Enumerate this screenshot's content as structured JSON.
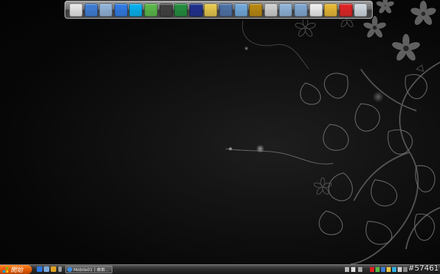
{
  "desktop": {
    "wallpaper": "dark-floral-vines",
    "background_color": "#050505"
  },
  "dock": {
    "icons": [
      {
        "name": "notepad-icon",
        "color": "#e8e8e8"
      },
      {
        "name": "network-globe-icon",
        "color": "#3a7bd5"
      },
      {
        "name": "folder-icon",
        "color": "#8fb3d9"
      },
      {
        "name": "internet-explorer-icon",
        "color": "#2b78e4"
      },
      {
        "name": "skype-icon",
        "color": "#00aff0"
      },
      {
        "name": "msn-messenger-icon",
        "color": "#57b846"
      },
      {
        "name": "qq-penguin-icon",
        "color": "#3c3c3c"
      },
      {
        "name": "tree-app-icon",
        "color": "#1e8c3a"
      },
      {
        "name": "diamond-app-icon",
        "color": "#1a2c8c"
      },
      {
        "name": "folder-search-icon",
        "color": "#e8c84a"
      },
      {
        "name": "network-connection-icon",
        "color": "#4a6fa5"
      },
      {
        "name": "cloud-icon",
        "color": "#6fa8dc"
      },
      {
        "name": "warcraft-icon",
        "color": "#b8860b"
      },
      {
        "name": "music-app-icon",
        "color": "#d0d0d0"
      },
      {
        "name": "folder-2-icon",
        "color": "#8fb3d9"
      },
      {
        "name": "folder-3-icon",
        "color": "#7ea6d2"
      },
      {
        "name": "document-icon",
        "color": "#f0f0f0"
      },
      {
        "name": "contacts-icon",
        "color": "#e8b830"
      },
      {
        "name": "antivirus-icon",
        "color": "#e02020"
      },
      {
        "name": "recycle-bin-icon",
        "color": "#cfd8e0"
      }
    ]
  },
  "taskbar": {
    "start_label": "開始",
    "start_color": "#e05a00",
    "quick_launch": [
      "ie-icon",
      "desktop-icon",
      "media-icon",
      "more-icon"
    ],
    "window": {
      "label": "Mobile01 | 桌面..."
    },
    "tray": [
      "network-icon",
      "volume-icon",
      "antivirus-tray-icon",
      "messenger-tray-icon",
      "app-tray-icon",
      "app-tray-icon-2",
      "update-tray-icon",
      "speaker-tray-icon",
      "clock-tray-icon"
    ]
  },
  "watermark": "#57461"
}
